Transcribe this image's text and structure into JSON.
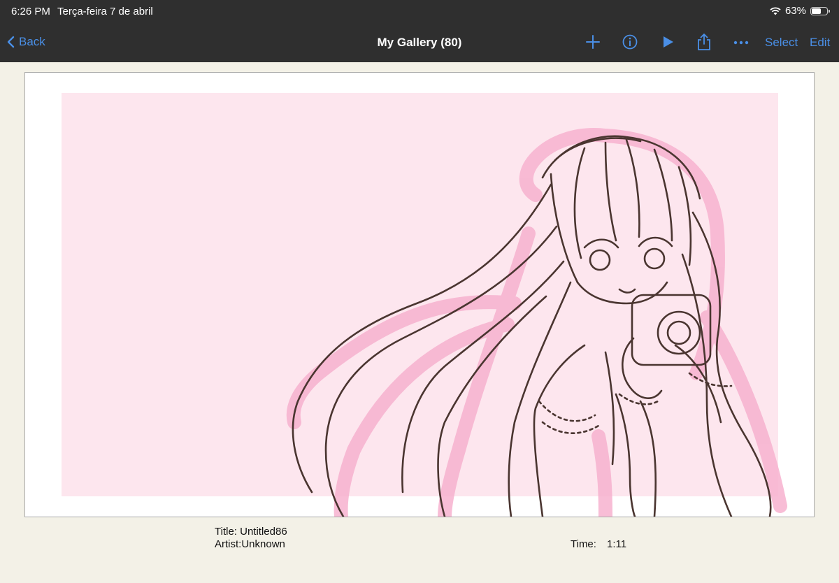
{
  "status_bar": {
    "time": "6:26 PM",
    "date": "Terça-feira 7 de abril",
    "battery": "63%",
    "battery_level": 0.63
  },
  "nav": {
    "back_label": "Back",
    "title": "My Gallery (80)",
    "select_label": "Select",
    "edit_label": "Edit",
    "icons": [
      "plus-icon",
      "info-icon",
      "play-icon",
      "share-icon",
      "more-icon"
    ]
  },
  "artwork": {
    "background_color": "#fde6ee",
    "line_color": "#4a3530"
  },
  "details": {
    "title": "Title: Untitled86",
    "artist": "Artist:Unknown",
    "time_label": "Time:",
    "time_value": "1:11"
  }
}
